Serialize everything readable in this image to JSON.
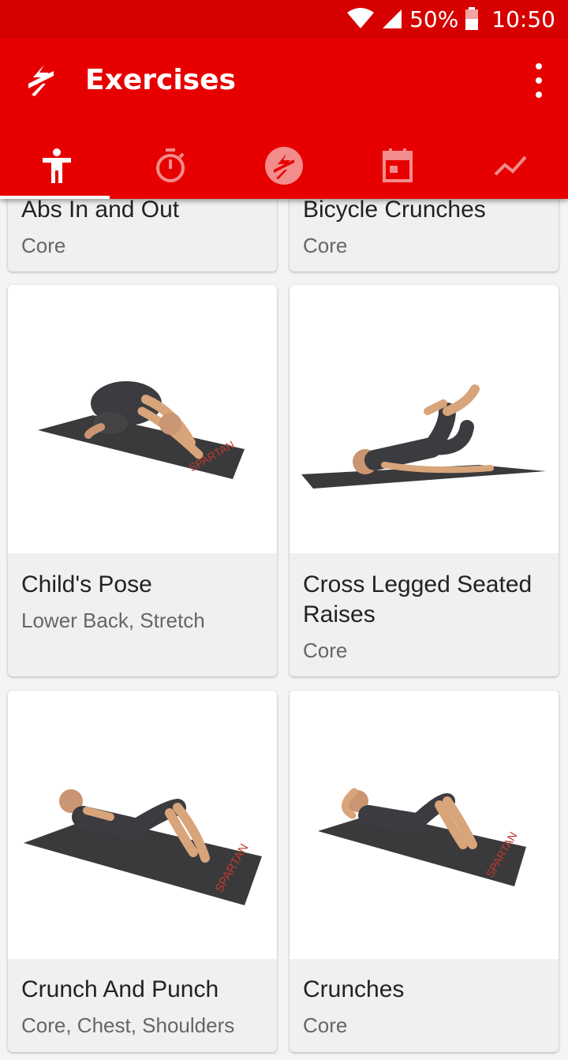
{
  "status": {
    "battery": "50%",
    "time": "10:50"
  },
  "app_bar": {
    "title": "Exercises",
    "tabs": [
      {
        "icon": "person-icon",
        "active": true
      },
      {
        "icon": "stopwatch-icon",
        "active": false
      },
      {
        "icon": "spartan-logo-icon",
        "active": false
      },
      {
        "icon": "calendar-icon",
        "active": false
      },
      {
        "icon": "trend-icon",
        "active": false
      }
    ]
  },
  "exercises": [
    {
      "name": "Abs In and Out",
      "category": "Core"
    },
    {
      "name": "Bicycle Crunches",
      "category": "Core"
    },
    {
      "name": "Child's Pose",
      "category": "Lower Back, Stretch"
    },
    {
      "name": "Cross Legged Seated Raises",
      "name_line1": "Cross Legged Seated",
      "name_line2": "Raises",
      "category": "Core"
    },
    {
      "name": "Crunch And Punch",
      "category": "Core, Chest, Shoulders"
    },
    {
      "name": "Crunches",
      "category": "Core"
    }
  ],
  "mat_brand": "SPARTAN",
  "colors": {
    "primary": "#e60000",
    "status_bar": "#d60000",
    "mat": "#3a3a3c",
    "brand_red": "#c0392b"
  }
}
